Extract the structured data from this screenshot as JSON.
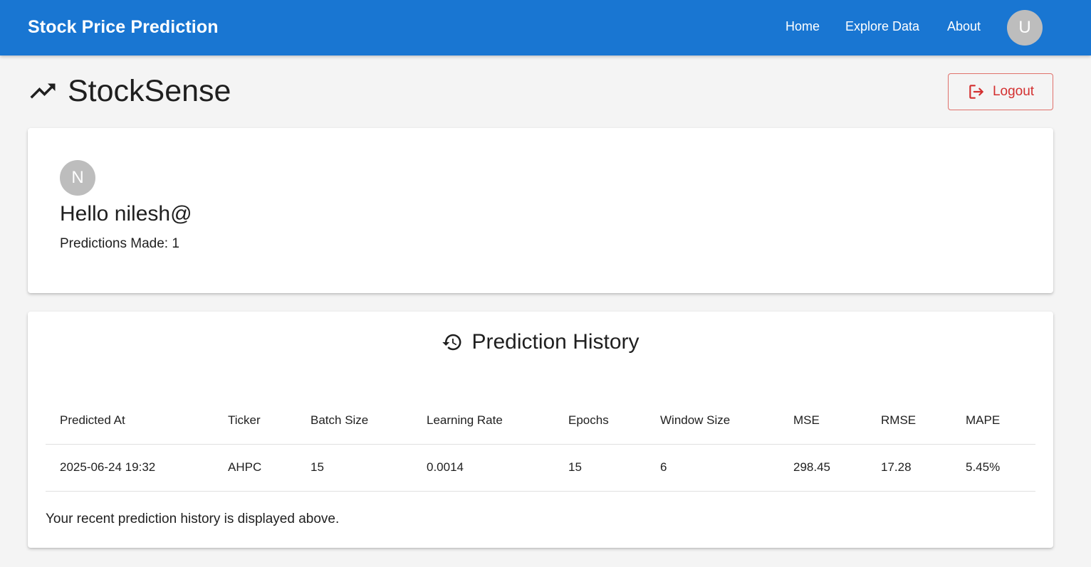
{
  "appbar": {
    "brand": "Stock Price Prediction",
    "nav": [
      {
        "label": "Home"
      },
      {
        "label": "Explore Data"
      },
      {
        "label": "About"
      }
    ],
    "avatar_letter": "U",
    "color": "#1976d2"
  },
  "header": {
    "icon": "trending-up-icon",
    "title": "StockSense",
    "logout_label": "Logout",
    "logout_icon": "logout-icon"
  },
  "profile": {
    "avatar_letter": "N",
    "greeting": "Hello nilesh@",
    "predictions_made": "Predictions Made: 1"
  },
  "history": {
    "icon": "history-icon",
    "title": "Prediction History",
    "columns": [
      "Predicted At",
      "Ticker",
      "Batch Size",
      "Learning Rate",
      "Epochs",
      "Window Size",
      "MSE",
      "RMSE",
      "MAPE"
    ],
    "rows": [
      [
        "2025-06-24 19:32",
        "AHPC",
        "15",
        "0.0014",
        "15",
        "6",
        "298.45",
        "17.28",
        "5.45%"
      ]
    ],
    "footnote": "Your recent prediction history is displayed above."
  }
}
